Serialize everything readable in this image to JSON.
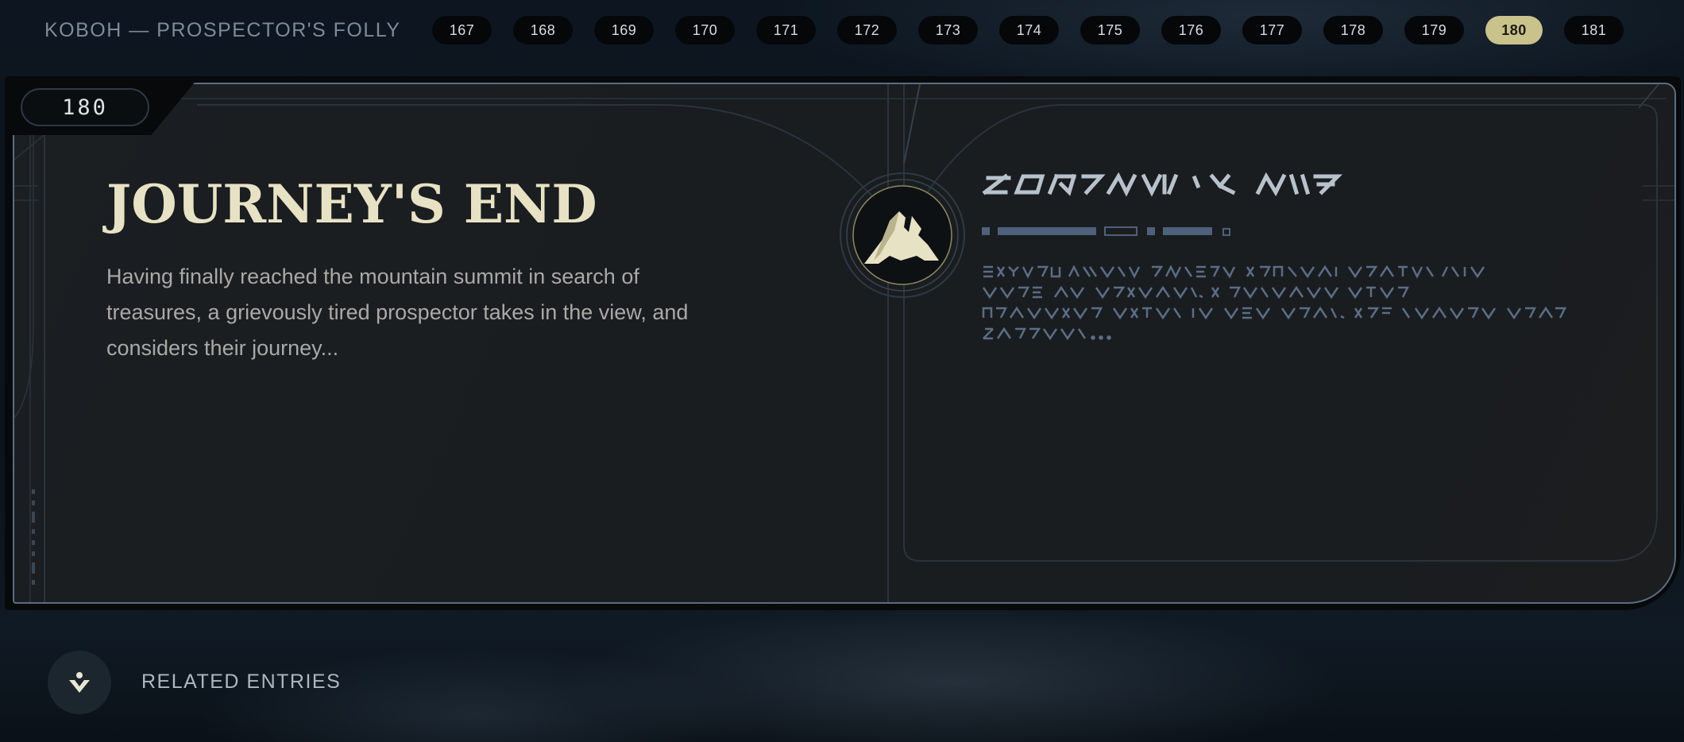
{
  "header": {
    "breadcrumb": "KOBOH — PROSPECTOR'S FOLLY",
    "pages": [
      "167",
      "168",
      "169",
      "170",
      "171",
      "172",
      "173",
      "174",
      "175",
      "176",
      "177",
      "178",
      "179",
      "180",
      "181"
    ],
    "active_page": "180"
  },
  "entry": {
    "number": "180",
    "title": "JOURNEY'S END",
    "description": "Having finally reached the mountain summit in search of treasures, a grievously tired prospector takes in the view, and considers their journey..."
  },
  "related": {
    "label": "RELATED ENTRIES"
  },
  "colors": {
    "accent": "#c9c28a",
    "title": "#e8e2c4",
    "aurebesh": "#5b6d86",
    "frame": "#5b6d82"
  },
  "icons": {
    "emblem": "mountain-emblem-icon",
    "related": "related-entries-icon"
  }
}
